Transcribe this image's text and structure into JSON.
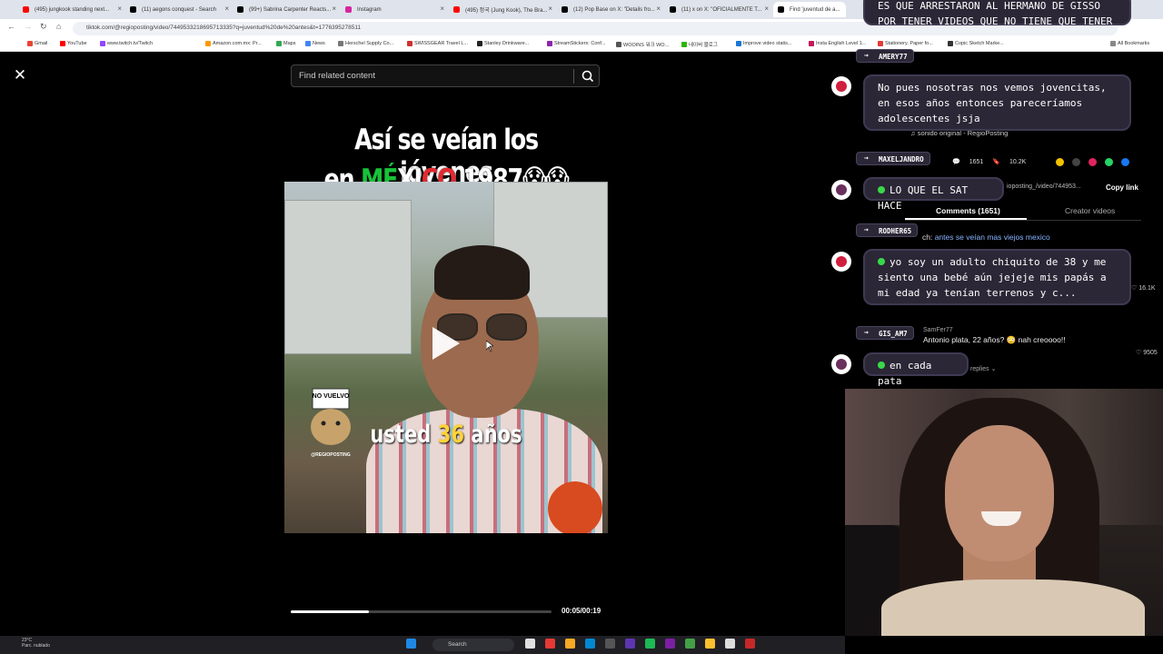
{
  "browser": {
    "tabs": [
      {
        "label": "(495) jungkook standing next...",
        "color": "#ff0000"
      },
      {
        "label": "(11) aegons conquest - Search",
        "color": "#000000"
      },
      {
        "label": "(99+) Sabrina Carpenter Reacts...",
        "color": "#000000"
      },
      {
        "label": "Instagram",
        "color": "#d6249f"
      },
      {
        "label": "(495) 정국 (Jung Kook), The Bra...",
        "color": "#ff0000"
      },
      {
        "label": "(12) Pop Base on X: \"Details fro...",
        "color": "#000000"
      },
      {
        "label": "(11) x on X: \"OFICIALMENTE T...",
        "color": "#000000"
      },
      {
        "label": "Find 'juventud de a...",
        "color": "#000000"
      }
    ],
    "address": "tiktok.com/@regioposting/video/7449533218695713335?q=juventud%20de%20antes&t=1776395278511",
    "bookmarks": [
      "Gmail",
      "YouTube",
      "www.twitch.tv/Twitch",
      "Amazon.com.mx: Pr...",
      "Maps",
      "News",
      "Herschel Supply Co...",
      "SWISSGEAR Travel L...",
      "Stanley Drinkware...",
      "StreamStickers: Conf...",
      "WOOINS 워크 WO...",
      "네이버 블로그",
      "Improve video statis...",
      "Insta English Level 1...",
      "Stationery, Paper fo...",
      "Copic Sketch Marke...",
      "All Bookmarks"
    ]
  },
  "search": {
    "placeholder": "Find related content"
  },
  "video": {
    "title_line1": "Así se veían los jóvenes",
    "title_line2_a": "en ",
    "title_line2_me": "MÉ",
    "title_line2_xi": "XI",
    "title_line2_co": "CO",
    "title_line2_b": " 1987😱😱",
    "subtitle_a": "usted ",
    "subtitle_num": "36",
    "subtitle_b": " años",
    "sticker_text": "NO VUELVO",
    "sticker_brand": "@REGIOPOSTING",
    "time": "00:05/00:19",
    "progress": 0.3
  },
  "tiktok_panel": {
    "music": "♫  sonido original - RegioPosting",
    "stats": {
      "comments": "1651",
      "saves": "10.2K"
    },
    "link": "ioposting_/video/744953...",
    "copy_link": "Copy link",
    "tab_comments": "Comments (1651)",
    "tab_creator": "Creator videos",
    "comment1_prefix": "ch: ",
    "comment1": "antes se veían mas viejos mexico",
    "like1": "♡ 16.1K",
    "comment2_user": "SamFer77",
    "comment2": "Antonio plata, 22 años? 😳 nah creoooo!!",
    "like2": "♡ 9505",
    "replies": "replies ⌄"
  },
  "chat": {
    "top_message": "ES QUE ARRESTARON AL HERMANO DE GISSO POR TENER VIDEOS QUE NO TIENE QUE TENER",
    "messages": [
      {
        "user": "AMERY77",
        "text": "No pues nosotras nos vemos jovencitas, en esos años entonces pareceríamos adolescentes jsja"
      },
      {
        "user": "MAXELJANDRO",
        "text": "LO QUE EL SAT HACE"
      },
      {
        "user": "RODHER65",
        "text": "yo soy un adulto chiquito de 38 y me siento una bebé aún jejeje mis papás a mi edad ya tenían terrenos y c..."
      },
      {
        "user": "GIS_AM7",
        "text": "en cada pata"
      }
    ]
  },
  "taskbar": {
    "weather_temp": "23°C",
    "weather_desc": "Parc. nublado",
    "search": "Search"
  }
}
